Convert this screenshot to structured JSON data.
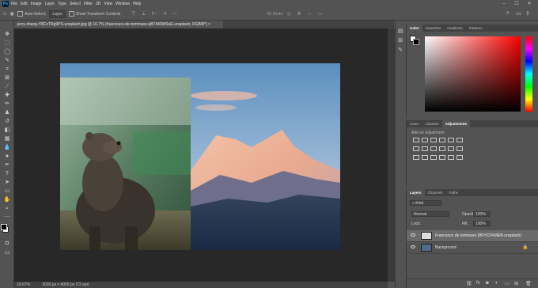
{
  "menubar": {
    "items": [
      "File",
      "Edit",
      "Image",
      "Layer",
      "Type",
      "Select",
      "Filter",
      "3D",
      "View",
      "Window",
      "Help"
    ],
    "logo": "Ps",
    "window_controls": [
      "–",
      "☐",
      "✕"
    ]
  },
  "options": {
    "auto_select": "Auto-Select:",
    "layer_select": "Layer",
    "transform": "Show Transform Controls",
    "mode3d": "3D Mode:"
  },
  "document": {
    "tab_title": "jerry-zhang-Y8CxTRg9PS-unsplash.jpg @ 16.7% (francesco-de-tommaso-qB7440WSsE-unsplash, RGB/8*) ×"
  },
  "status": {
    "zoom": "16.67%",
    "doc_size": "3000 px x 4000 px (72 ppi)"
  },
  "color_panel": {
    "tabs": [
      "Color",
      "Swatches",
      "Gradients",
      "Patterns"
    ],
    "active_tab": "Color",
    "hue_color": "#ff0000"
  },
  "adjust_panel": {
    "tabs": [
      "Learn",
      "Libraries",
      "Adjustments"
    ],
    "active_tab": "Adjustments",
    "add_label": "Add an adjustment"
  },
  "layers_panel": {
    "tabs": [
      "Layers",
      "Channels",
      "Paths"
    ],
    "active_tab": "Layers",
    "kind": "Kind",
    "blend": "Normal",
    "opacity_label": "Opacity:",
    "opacity_value": "100%",
    "lock_label": "Lock:",
    "fill_label": "Fill:",
    "fill_value": "100%",
    "layers": [
      {
        "name": "Francesco de tommaso (8FHCFKMEB-unsplash)",
        "selected": true
      },
      {
        "name": "Background",
        "selected": false
      }
    ],
    "footer_icons": [
      "link-icon",
      "fx-icon",
      "mask-icon",
      "adjustment-icon",
      "group-icon",
      "new-layer-icon",
      "trash-icon"
    ]
  },
  "tools": [
    "move-icon",
    "artboard-icon",
    "lasso-icon",
    "quick-select-icon",
    "crop-icon",
    "frame-icon",
    "eyedropper-icon",
    "healing-icon",
    "brush-icon",
    "stamp-icon",
    "history-brush-icon",
    "eraser-icon",
    "gradient-icon",
    "blur-icon",
    "dodge-icon",
    "pen-icon",
    "type-icon",
    "path-select-icon",
    "rectangle-icon",
    "hand-icon",
    "zoom-icon",
    "more-icon"
  ]
}
